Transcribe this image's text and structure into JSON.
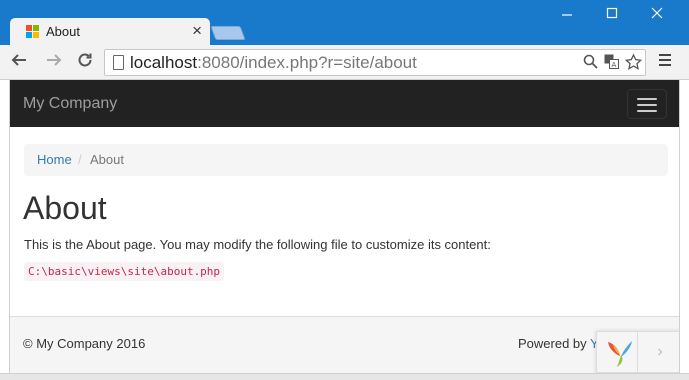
{
  "browser": {
    "tab_title": "About",
    "tab_close": "×",
    "url_host": "localhost",
    "url_rest": ":8080/index.php?r=site/about",
    "window_controls": [
      "minimize-icon",
      "maximize-icon",
      "close-icon"
    ],
    "accent_color": "#1979ca"
  },
  "navbar": {
    "brand": "My Company"
  },
  "breadcrumb": {
    "home": "Home",
    "separator": "/",
    "current": "About"
  },
  "content": {
    "title": "About",
    "lead": "This is the About page. You may modify the following file to customize its content:",
    "code": "C:\\basic\\views\\site\\about.php"
  },
  "footer": {
    "copyright": "© My Company 2016",
    "powered_prefix": "Powered by ",
    "powered_link": "Y"
  },
  "debug_toolbar": {
    "expand": "›"
  }
}
